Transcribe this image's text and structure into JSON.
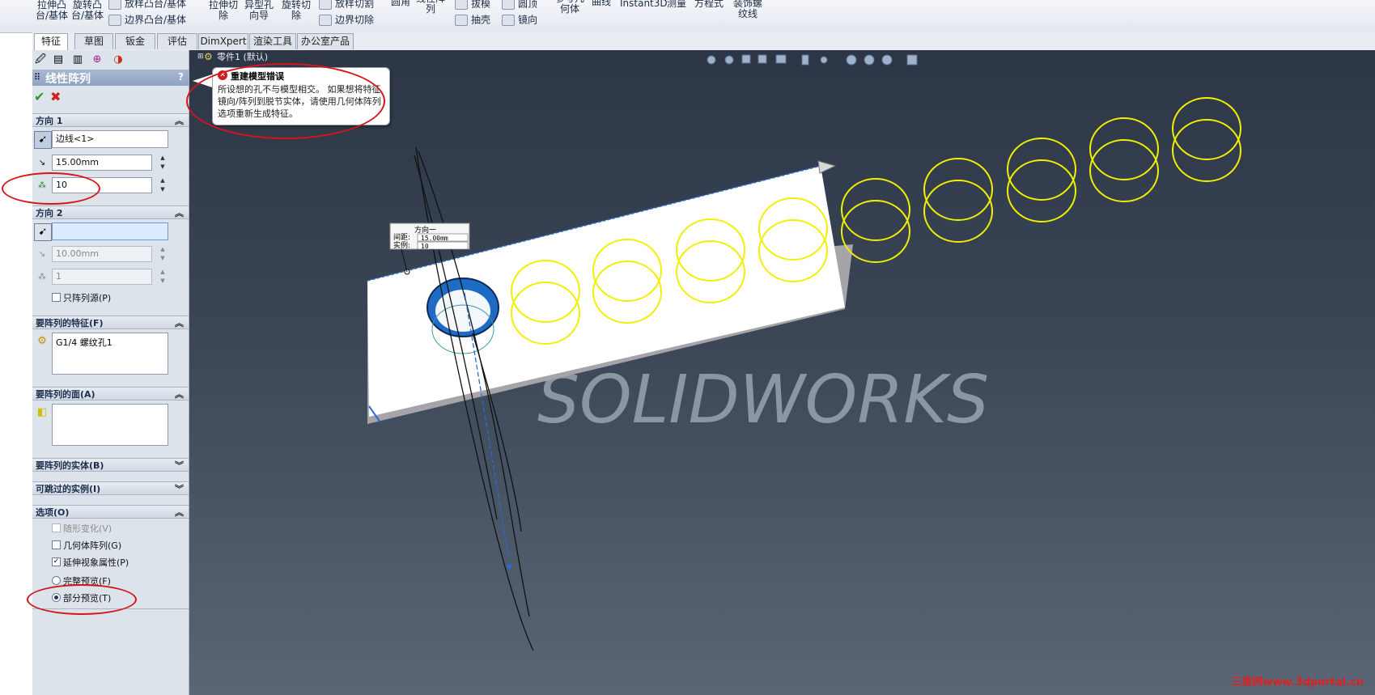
{
  "toolbar": {
    "items": [
      {
        "label": "拉伸凸\n台/基体"
      },
      {
        "label": "旋转凸\n台/基体"
      },
      {
        "label": "放样凸台/基体"
      },
      {
        "label": "边界凸台/基体"
      },
      {
        "label": "拉伸切\n除"
      },
      {
        "label": "异型孔\n向导"
      },
      {
        "label": "旋转切\n除"
      },
      {
        "label": "放样切割"
      },
      {
        "label": "边界切除"
      },
      {
        "label": "圆角"
      },
      {
        "label": "线性阵\n列"
      },
      {
        "label": "拔模"
      },
      {
        "label": "抽壳"
      },
      {
        "label": "圆顶"
      },
      {
        "label": "镜向"
      },
      {
        "label": "参考几\n何体"
      },
      {
        "label": "曲线"
      },
      {
        "label": "Instant3D"
      },
      {
        "label": "测量"
      },
      {
        "label": "方程式"
      },
      {
        "label": "装饰螺\n纹线"
      }
    ]
  },
  "tabs": [
    "特征",
    "草图",
    "钣金",
    "评估",
    "DimXpert",
    "渲染工具",
    "办公室产品"
  ],
  "property_manager": {
    "title": "线性阵列",
    "help": "?",
    "ok": "✔",
    "cancel": "✖",
    "direction1": {
      "header": "方向 1",
      "edge": "边线<1>",
      "spacing": "15.00mm",
      "instances": "10"
    },
    "direction2": {
      "header": "方向 2",
      "edge": "",
      "spacing": "10.00mm",
      "instances": "1",
      "only_seed": "只阵列源(P)"
    },
    "features": {
      "header": "要阵列的特征(F)",
      "item": "G1/4 螺纹孔1"
    },
    "faces": {
      "header": "要阵列的面(A)"
    },
    "bodies": {
      "header": "要阵列的实体(B)"
    },
    "skip": {
      "header": "可跳过的实例(I)"
    },
    "options": {
      "header": "选项(O)",
      "vary_sketch": "随形变化(V)",
      "geometry_pattern": "几何体阵列(G)",
      "propagate_visual": "延伸视象属性(P)",
      "full_preview": "完整预览(F)",
      "partial_preview": "部分预览(T)"
    }
  },
  "tree": {
    "root": "零件1 (默认)"
  },
  "error_callout": {
    "title": "重建模型错误",
    "message": "所设想的孔不与模型相交。 如果想将特征镜向/阵列到脱节实体，请使用几何体阵列选项重新生成特征。"
  },
  "dimension_box": {
    "title": "方向一",
    "spacing_label": "间距:",
    "spacing_value": "15.00mm",
    "instances_label": "实例:",
    "instances_value": "10"
  },
  "watermark": {
    "logo": "SOLIDWORKS",
    "site": "三维网www.3dportal.cn"
  },
  "colors": {
    "viewport_top": "#2c3646",
    "viewport_bottom": "#5a6676",
    "preview_circle": "#f0f000",
    "annotation_red": "#d4151a",
    "hole_blue": "#1565c0"
  }
}
